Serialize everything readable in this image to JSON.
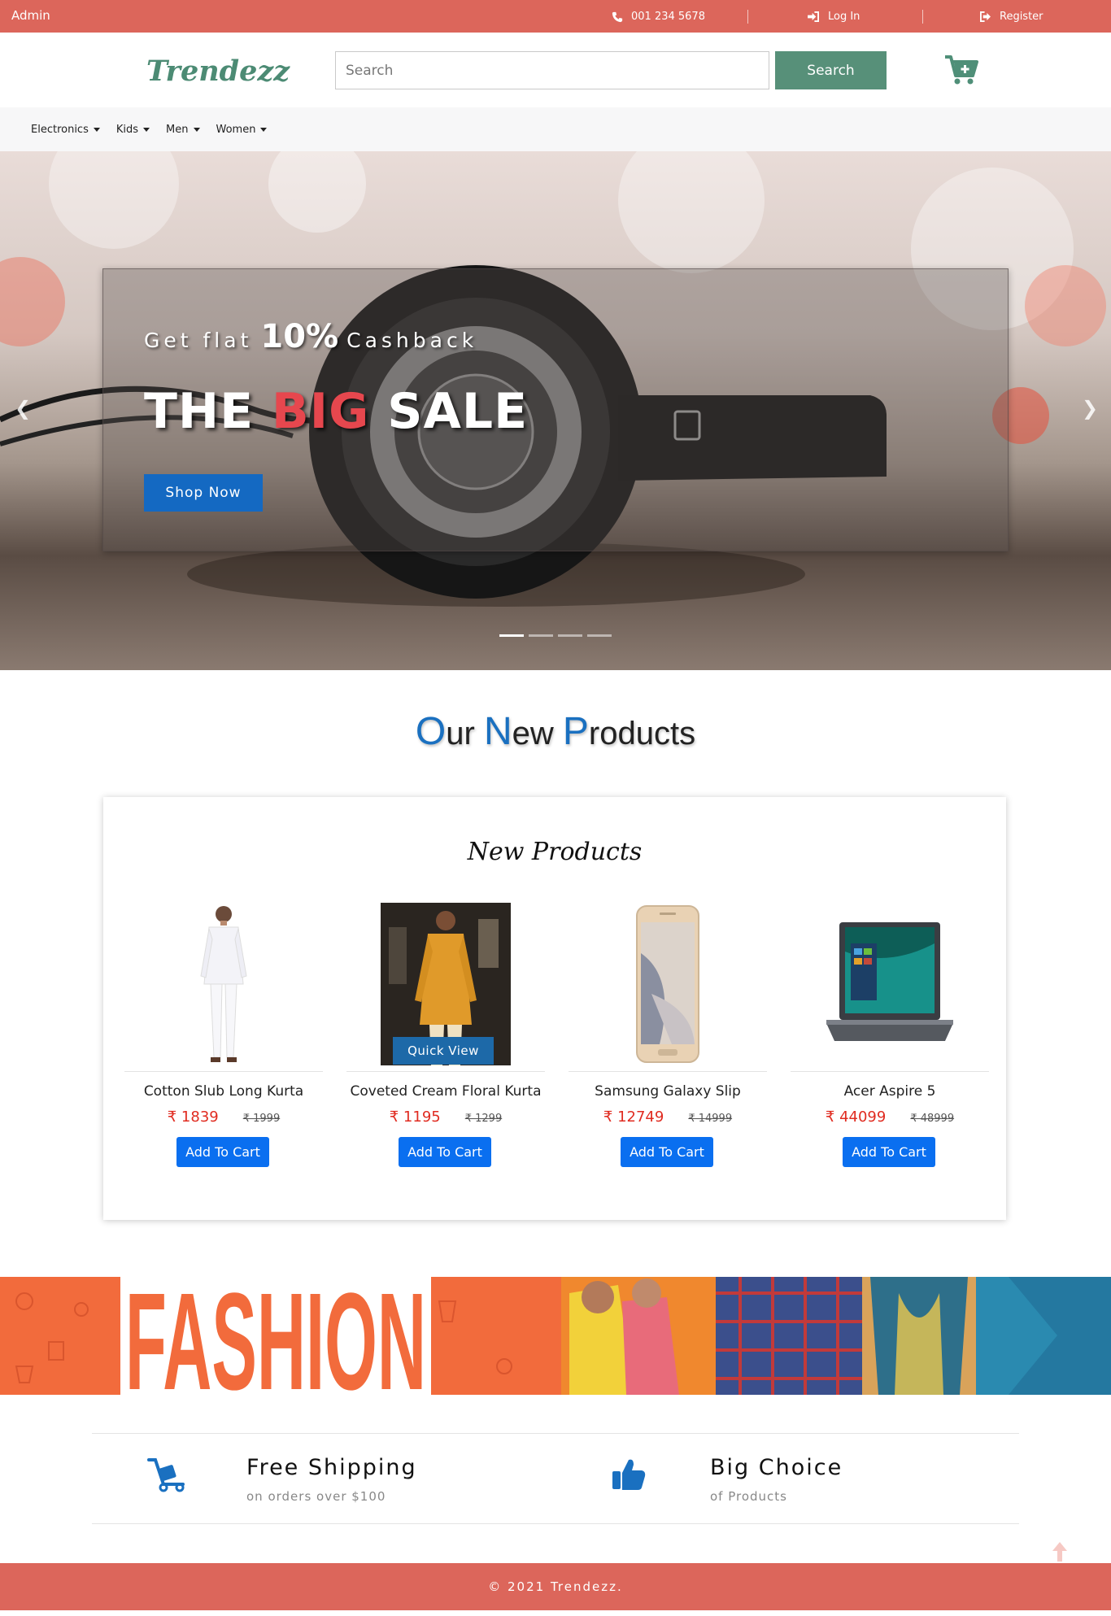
{
  "topbar": {
    "admin": "Admin",
    "phone": "001 234 5678",
    "login": "Log In",
    "register": "Register"
  },
  "header": {
    "logo": "Trendezz",
    "search_placeholder": "Search",
    "search_button": "Search"
  },
  "nav": {
    "items": [
      "Electronics",
      "Kids",
      "Men",
      "Women"
    ]
  },
  "hero": {
    "sub_pre": "Get flat",
    "sub_highlight": "10%",
    "sub_post": "Cashback",
    "title_the": "THE",
    "title_big": "BIG",
    "title_sale": "SALE",
    "button": "Shop Now",
    "slide_count": 4,
    "active_slide": 1
  },
  "section": {
    "title_o": "O",
    "title_ur": "ur ",
    "title_n": "N",
    "title_ew": "ew ",
    "title_p": "P",
    "title_roducts": "roducts"
  },
  "products_card": {
    "title": "New Products",
    "quick_view": "Quick View",
    "items": [
      {
        "name": "Cotton Slub Long Kurta",
        "price": "₹ 1839",
        "old_price": "₹ 1999",
        "button": "Add To Cart"
      },
      {
        "name": "Coveted Cream Floral Kurta",
        "price": "₹ 1195",
        "old_price": "₹ 1299",
        "button": "Add To Cart"
      },
      {
        "name": "Samsung Galaxy Slip",
        "price": "₹ 12749",
        "old_price": "₹ 14999",
        "button": "Add To Cart"
      },
      {
        "name": "Acer Aspire 5",
        "price": "₹ 44099",
        "old_price": "₹ 48999",
        "button": "Add To Cart"
      }
    ]
  },
  "banner": {
    "text": "FASHION"
  },
  "features": [
    {
      "title": "Free Shipping",
      "subtitle": "on orders over $100",
      "icon": "shipping-trolley-icon"
    },
    {
      "title": "Big Choice",
      "subtitle": "of Products",
      "icon": "thumbs-up-icon"
    }
  ],
  "footer": {
    "copyright": "© 2021 Trendezz."
  },
  "colors": {
    "topbar": "#dc665b",
    "brand_green": "#579079",
    "accent_blue": "#1a70c0",
    "price_red": "#e02b20",
    "button_blue": "#0a6ff0"
  }
}
